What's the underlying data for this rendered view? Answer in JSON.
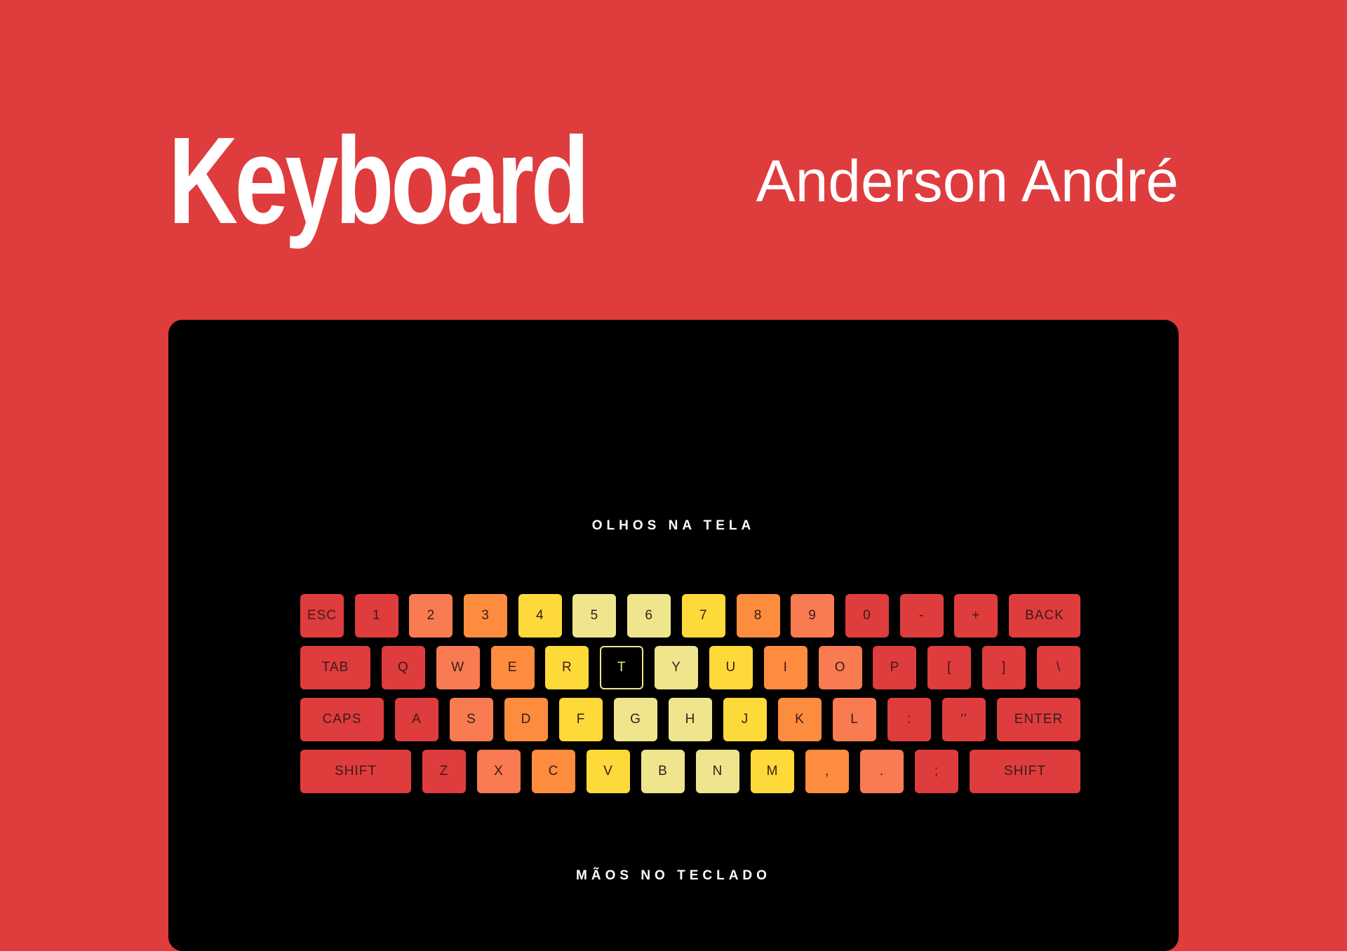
{
  "header": {
    "title": "Keyboard",
    "author": "Anderson André"
  },
  "panel": {
    "top_caption": "OLHOS NA TELA",
    "bottom_caption": "MÃOS NO TECLADO"
  },
  "colors": {
    "background": "#df3c3e",
    "panel": "#000000",
    "red": "#df3c3e",
    "coral": "#f87b51",
    "orange": "#fd8c3f",
    "yellow": "#fed93a",
    "pale": "#efe58d",
    "active_border": "#efe58d"
  },
  "keyboard": {
    "active_key": "T",
    "rows": [
      [
        {
          "label": "ESC",
          "color": "red"
        },
        {
          "label": "1",
          "color": "red"
        },
        {
          "label": "2",
          "color": "coral"
        },
        {
          "label": "3",
          "color": "orange"
        },
        {
          "label": "4",
          "color": "yellow"
        },
        {
          "label": "5",
          "color": "pale"
        },
        {
          "label": "6",
          "color": "pale"
        },
        {
          "label": "7",
          "color": "yellow"
        },
        {
          "label": "8",
          "color": "orange"
        },
        {
          "label": "9",
          "color": "coral"
        },
        {
          "label": "0",
          "color": "red"
        },
        {
          "label": "-",
          "color": "red"
        },
        {
          "label": "+",
          "color": "red"
        },
        {
          "label": "BACK",
          "color": "red"
        }
      ],
      [
        {
          "label": "TAB",
          "color": "red"
        },
        {
          "label": "Q",
          "color": "red"
        },
        {
          "label": "W",
          "color": "coral"
        },
        {
          "label": "E",
          "color": "orange"
        },
        {
          "label": "R",
          "color": "yellow"
        },
        {
          "label": "T",
          "color": "pale"
        },
        {
          "label": "Y",
          "color": "pale"
        },
        {
          "label": "U",
          "color": "yellow"
        },
        {
          "label": "I",
          "color": "orange"
        },
        {
          "label": "O",
          "color": "coral"
        },
        {
          "label": "P",
          "color": "red"
        },
        {
          "label": "[",
          "color": "red"
        },
        {
          "label": "]",
          "color": "red"
        },
        {
          "label": "\\",
          "color": "red"
        }
      ],
      [
        {
          "label": "CAPS",
          "color": "red"
        },
        {
          "label": "A",
          "color": "red"
        },
        {
          "label": "S",
          "color": "coral"
        },
        {
          "label": "D",
          "color": "orange"
        },
        {
          "label": "F",
          "color": "yellow"
        },
        {
          "label": "G",
          "color": "pale"
        },
        {
          "label": "H",
          "color": "pale"
        },
        {
          "label": "J",
          "color": "yellow"
        },
        {
          "label": "K",
          "color": "orange"
        },
        {
          "label": "L",
          "color": "coral"
        },
        {
          "label": ":",
          "color": "red"
        },
        {
          "label": "''",
          "color": "red"
        },
        {
          "label": "ENTER",
          "color": "red"
        }
      ],
      [
        {
          "label": "SHIFT",
          "color": "red"
        },
        {
          "label": "Z",
          "color": "red"
        },
        {
          "label": "X",
          "color": "coral"
        },
        {
          "label": "C",
          "color": "orange"
        },
        {
          "label": "V",
          "color": "yellow"
        },
        {
          "label": "B",
          "color": "pale"
        },
        {
          "label": "N",
          "color": "pale"
        },
        {
          "label": "M",
          "color": "yellow"
        },
        {
          "label": ",",
          "color": "orange"
        },
        {
          "label": ".",
          "color": "coral"
        },
        {
          "label": ";",
          "color": "red"
        },
        {
          "label": "SHIFT",
          "color": "red"
        }
      ]
    ]
  }
}
